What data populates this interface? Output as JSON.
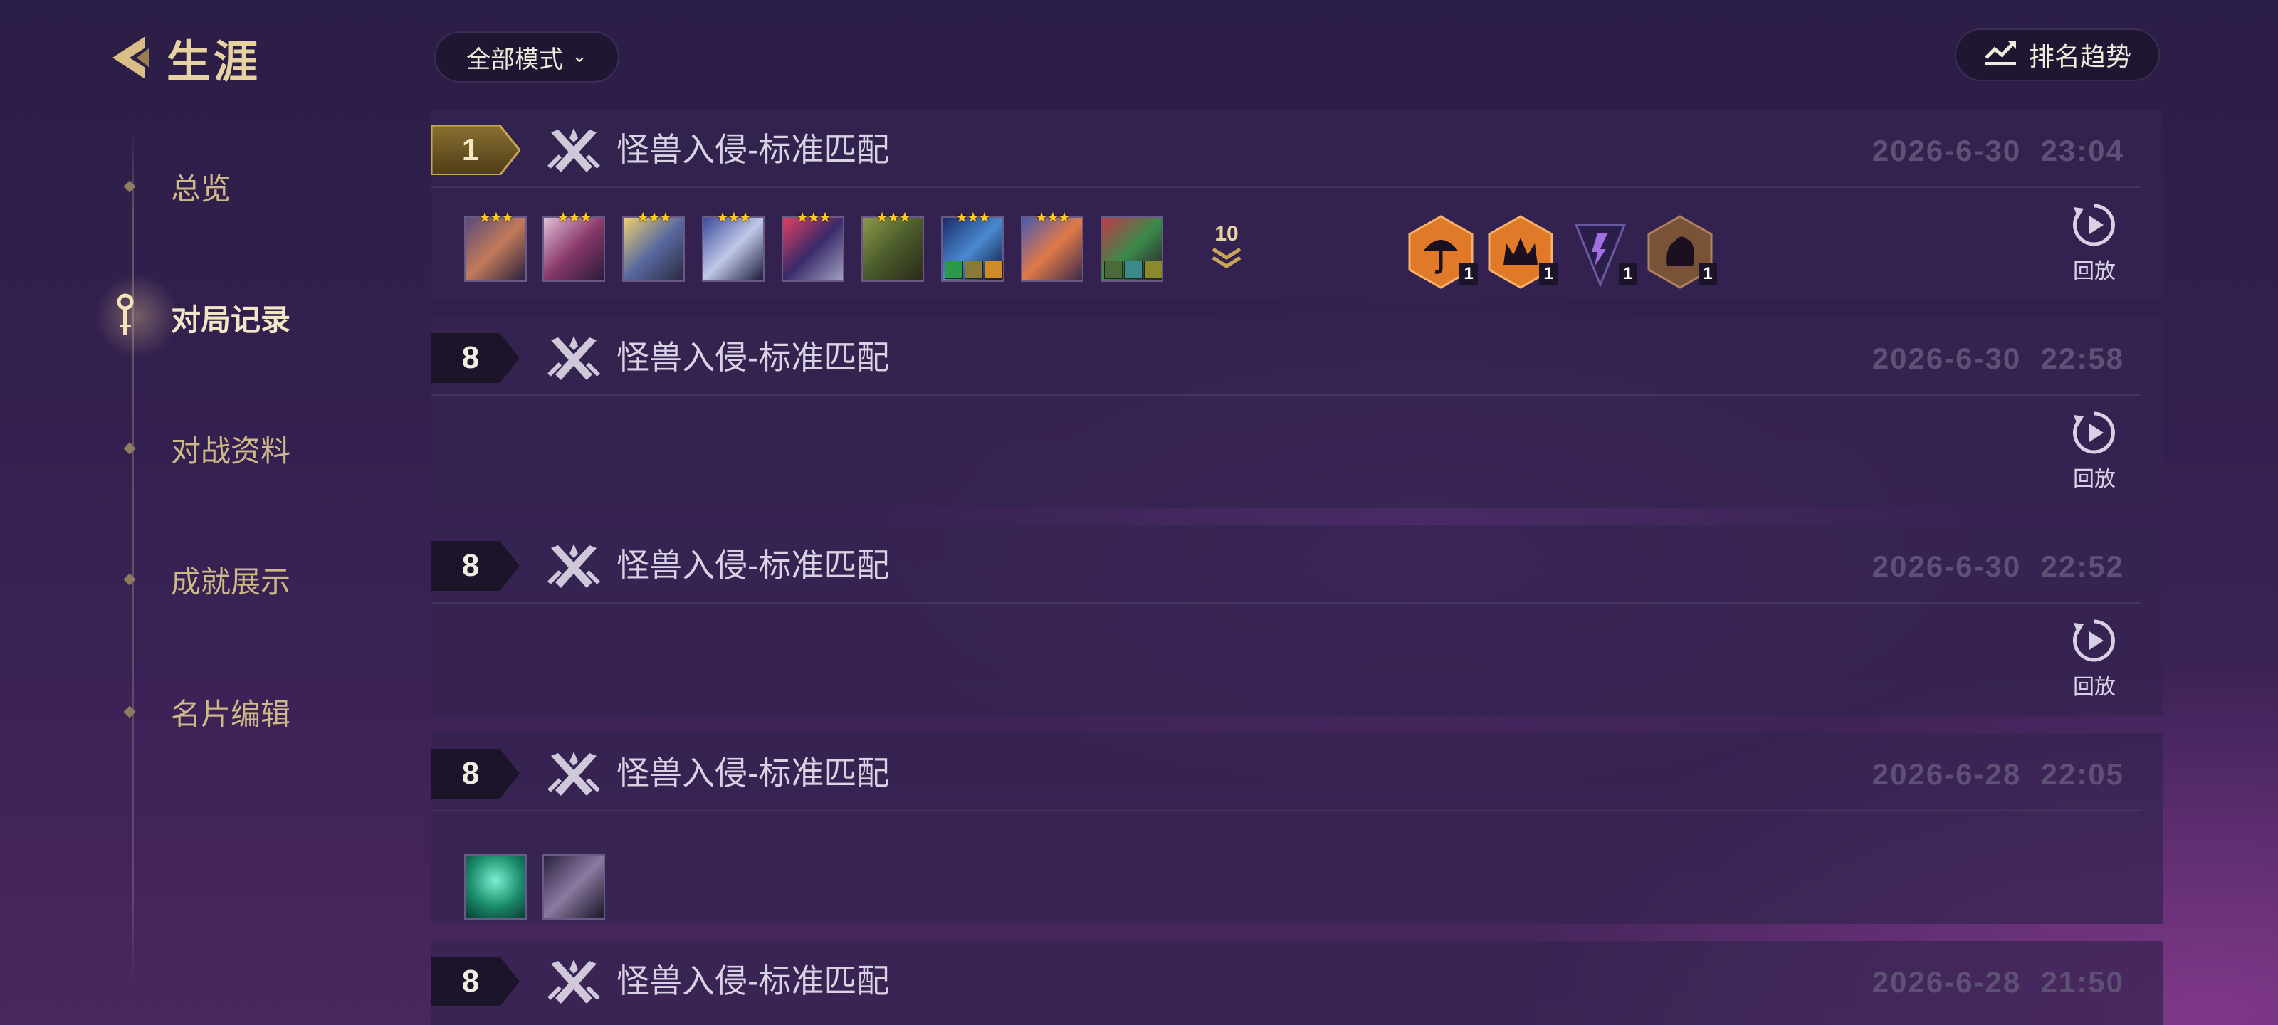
{
  "sidebar": {
    "title": "生涯",
    "items": [
      {
        "label": "总览",
        "active": false
      },
      {
        "label": "对局记录",
        "active": true
      },
      {
        "label": "对战资料",
        "active": false
      },
      {
        "label": "成就展示",
        "active": false
      },
      {
        "label": "名片编辑",
        "active": false
      }
    ]
  },
  "filter": {
    "mode_label": "全部模式"
  },
  "trend_button": {
    "label": "排名趋势"
  },
  "matches": [
    {
      "rank": "1",
      "mode": "怪兽入侵-标准匹配",
      "date": "2026-6-30",
      "time": "23:04",
      "more_count": "10",
      "replay_label": "回放",
      "trait_counts": [
        "1",
        "1",
        "1",
        "1"
      ]
    },
    {
      "rank": "8",
      "mode": "怪兽入侵-标准匹配",
      "date": "2026-6-30",
      "time": "22:58",
      "replay_label": "回放"
    },
    {
      "rank": "8",
      "mode": "怪兽入侵-标准匹配",
      "date": "2026-6-30",
      "time": "22:52",
      "replay_label": "回放"
    },
    {
      "rank": "8",
      "mode": "怪兽入侵-标准匹配",
      "date": "2026-6-28",
      "time": "22:05"
    },
    {
      "rank": "8",
      "mode": "怪兽入侵-标准匹配",
      "date": "2026-6-28",
      "time": "21:50"
    }
  ],
  "colors": {
    "gold": "#e7d3a2",
    "card_bg": "#342450",
    "trait_orange": "#f08a2c",
    "trait_purple": "#3a2a6a",
    "trait_bronze": "#8a5a3a"
  }
}
